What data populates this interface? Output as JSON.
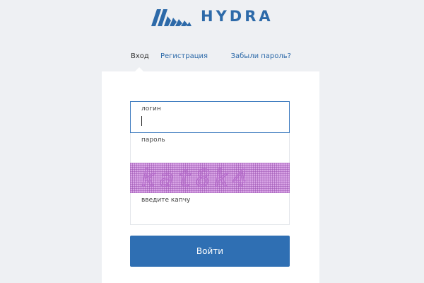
{
  "brand": {
    "name": "HYDRA",
    "color": "#2d6aa9"
  },
  "tabs": {
    "login": "Вход",
    "register": "Регистрация",
    "forgot": "Забыли пароль?"
  },
  "form": {
    "login_label": "логин",
    "login_value": "",
    "password_label": "пароль",
    "password_value": "",
    "captcha_text": "kat8k4",
    "captcha_label": "введите капчу",
    "captcha_value": "",
    "submit_label": "Войти",
    "submit_color": "#2f6fb3"
  }
}
